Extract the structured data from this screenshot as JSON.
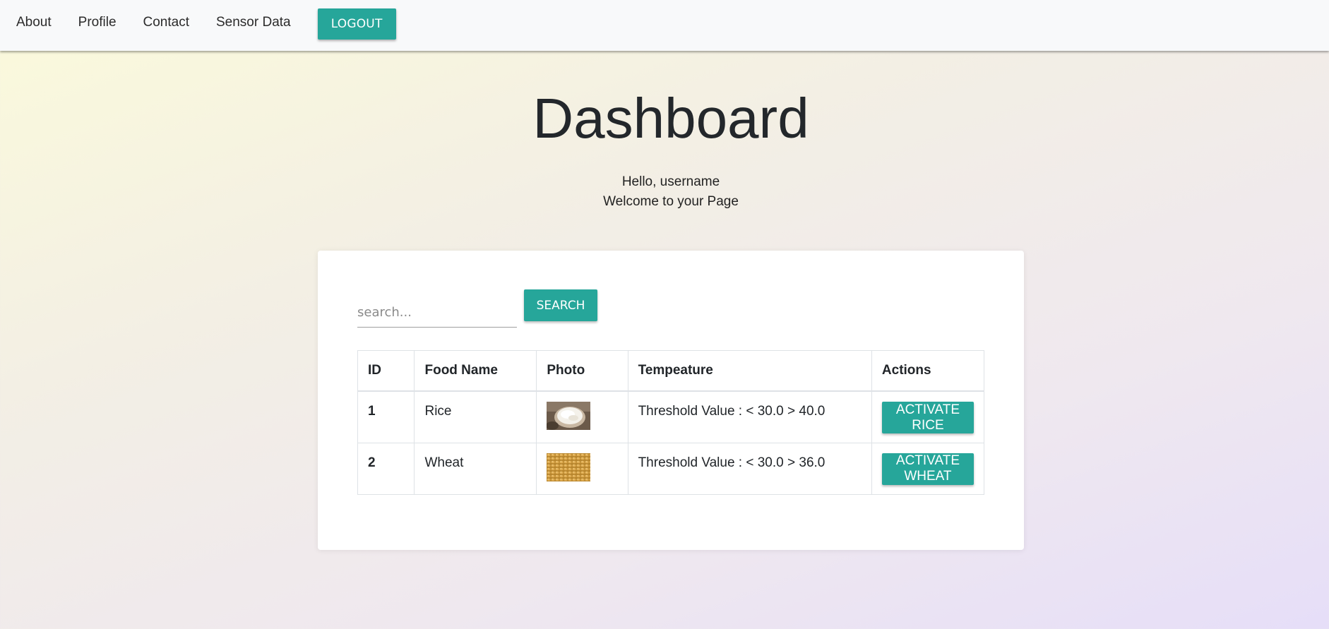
{
  "nav": {
    "links": [
      "About",
      "Profile",
      "Contact",
      "Sensor Data"
    ],
    "logout_label": "LOGOUT"
  },
  "header": {
    "title": "Dashboard",
    "hello": "Hello, username",
    "welcome": "Welcome to your Page"
  },
  "search": {
    "placeholder": "search...",
    "button_label": "SEARCH"
  },
  "table": {
    "columns": [
      "ID",
      "Food Name",
      "Photo",
      "Tempeature",
      "Actions"
    ],
    "rows": [
      {
        "id": "1",
        "name": "Rice",
        "photo": "rice-photo",
        "threshold": "Threshold Value : < 30.0 > 40.0",
        "action_label": "ACTIVATE RICE"
      },
      {
        "id": "2",
        "name": "Wheat",
        "photo": "wheat-photo",
        "threshold": "Threshold Value : < 30.0 > 36.0",
        "action_label": "ACTIVATE WHEAT"
      }
    ]
  },
  "colors": {
    "accent": "#26a69a",
    "navbar_bg": "#f8f9fa",
    "card_bg": "#ffffff"
  }
}
